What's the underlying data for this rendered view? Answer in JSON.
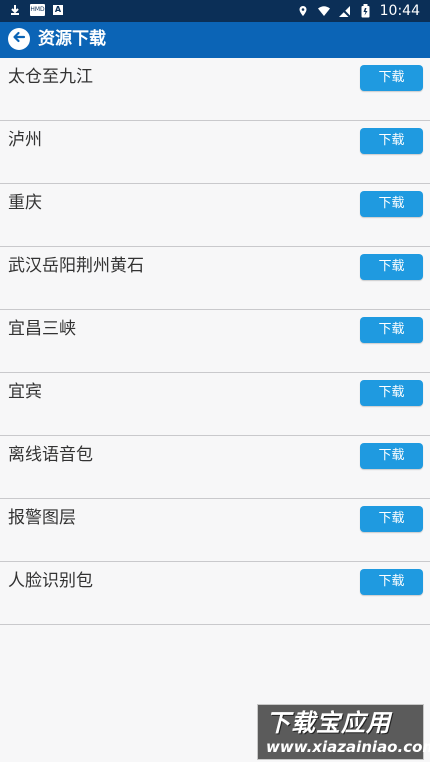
{
  "status_bar": {
    "time": "10:44",
    "notification_icons": [
      "download-icon",
      "hmd-box-icon",
      "a-box-icon"
    ],
    "status_icons": [
      "location-icon",
      "wifi-icon",
      "signal-off-icon",
      "battery-icon"
    ],
    "hmd_label": "HMD",
    "a_label": "A"
  },
  "app_bar": {
    "title": "资源下载",
    "back_icon": "back-arrow-icon"
  },
  "resources": [
    {
      "name": "太仓至九江",
      "button_label": "下载"
    },
    {
      "name": "泸州",
      "button_label": "下载"
    },
    {
      "name": "重庆",
      "button_label": "下载"
    },
    {
      "name": "武汉岳阳荆州黄石",
      "button_label": "下载"
    },
    {
      "name": "宜昌三峡",
      "button_label": "下载"
    },
    {
      "name": "宜宾",
      "button_label": "下载"
    },
    {
      "name": "离线语音包",
      "button_label": "下载"
    },
    {
      "name": "报警图层",
      "button_label": "下载"
    },
    {
      "name": "人脸识别包",
      "button_label": "下载"
    }
  ],
  "watermark": {
    "title": "下载宝应用",
    "url": "www.xiazainiao.com"
  },
  "colors": {
    "status_bar": "#0b2f57",
    "app_bar": "#0b64b6",
    "button": "#1f9ae0",
    "divider": "#c9c9cc",
    "background": "#f7f7f8"
  }
}
